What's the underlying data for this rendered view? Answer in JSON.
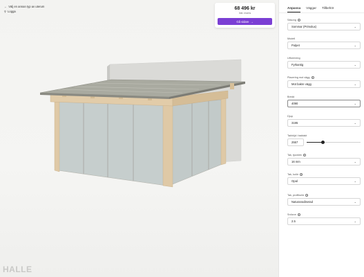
{
  "nav": {
    "back_label": "Välj en annan typ av uterum",
    "login_label": "Logga",
    "brand": "HALLE"
  },
  "price": {
    "amount": "68 496 kr",
    "subtitle": "Inkl. moms",
    "continue_label": "Gå vidare"
  },
  "tabs": [
    {
      "label": "Anpassa"
    },
    {
      "label": "Väggar"
    },
    {
      "label": "Tillbehör"
    }
  ],
  "fields": [
    {
      "label": "Säsong",
      "value": "Sommar (Primolux)"
    },
    {
      "label": "Modell",
      "value": "Pulpet"
    },
    {
      "label": "Utformning",
      "value": "Fyrkantig"
    },
    {
      "label": "Placering mot vägg",
      "value": "Mot bakre vägg"
    },
    {
      "label": "Bredd",
      "value": "4090"
    },
    {
      "label": "Djup",
      "value": "3195"
    },
    {
      "label": "Takhöjd i baktakt",
      "value": "2557"
    },
    {
      "label": "Tak, tjocklek",
      "value": "16 mm"
    },
    {
      "label": "Tak, kulör",
      "value": "Opal"
    },
    {
      "label": "Tak, profilkulör",
      "value": "Naturanodiserad"
    },
    {
      "label": "Snözon",
      "value": "2.5"
    }
  ],
  "takhojd_slider_fraction": 0.3,
  "colors": {
    "accent": "#7b3fd4",
    "wood": "#dcc6a3",
    "glass": "#c9d1d0",
    "wall": "#d9d9d6",
    "roof": "#a7a79c"
  },
  "icons": [
    "back-arrow-icon",
    "user-icon",
    "arrow-right-icon",
    "info-icon",
    "chevron-down-icon"
  ]
}
